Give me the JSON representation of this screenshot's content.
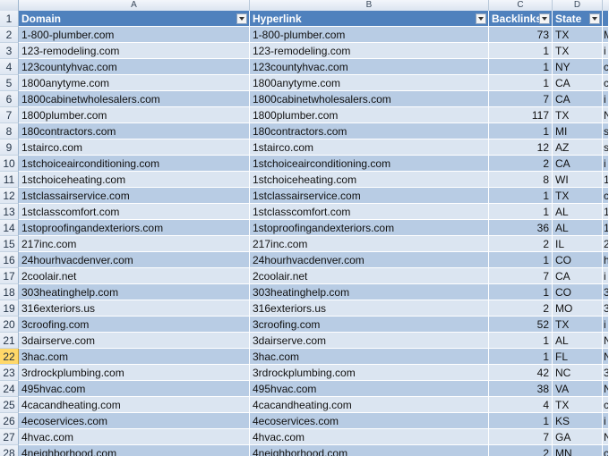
{
  "columns": [
    "A",
    "B",
    "C",
    "D"
  ],
  "table": {
    "headers": {
      "domain": "Domain",
      "hyperlink": "Hyperlink",
      "backlinks": "Backlinks",
      "state": "State"
    },
    "rows": [
      {
        "num": "2",
        "domain": "1-800-plumber.com",
        "hyperlink": "1-800-plumber.com",
        "backlinks": "73",
        "state": "TX",
        "e": "M"
      },
      {
        "num": "3",
        "domain": "123-remodeling.com",
        "hyperlink": "123-remodeling.com",
        "backlinks": "1",
        "state": "TX",
        "e": "i"
      },
      {
        "num": "4",
        "domain": "123countyhvac.com",
        "hyperlink": "123countyhvac.com",
        "backlinks": "1",
        "state": "NY",
        "e": "c"
      },
      {
        "num": "5",
        "domain": "1800anytyme.com",
        "hyperlink": "1800anytyme.com",
        "backlinks": "1",
        "state": "CA",
        "e": "c"
      },
      {
        "num": "6",
        "domain": "1800cabinetwholesalers.com",
        "hyperlink": "1800cabinetwholesalers.com",
        "backlinks": "7",
        "state": "CA",
        "e": "i"
      },
      {
        "num": "7",
        "domain": "1800plumber.com",
        "hyperlink": "1800plumber.com",
        "backlinks": "117",
        "state": "TX",
        "e": "N"
      },
      {
        "num": "8",
        "domain": "180contractors.com",
        "hyperlink": "180contractors.com",
        "backlinks": "1",
        "state": "MI",
        "e": "s"
      },
      {
        "num": "9",
        "domain": "1stairco.com",
        "hyperlink": "1stairco.com",
        "backlinks": "12",
        "state": "AZ",
        "e": "s"
      },
      {
        "num": "10",
        "domain": "1stchoiceairconditioning.com",
        "hyperlink": "1stchoiceairconditioning.com",
        "backlinks": "2",
        "state": "CA",
        "e": "i"
      },
      {
        "num": "11",
        "domain": "1stchoiceheating.com",
        "hyperlink": "1stchoiceheating.com",
        "backlinks": "8",
        "state": "WI",
        "e": "1"
      },
      {
        "num": "12",
        "domain": "1stclassairservice.com",
        "hyperlink": "1stclassairservice.com",
        "backlinks": "1",
        "state": "TX",
        "e": "c"
      },
      {
        "num": "13",
        "domain": "1stclasscomfort.com",
        "hyperlink": "1stclasscomfort.com",
        "backlinks": "1",
        "state": "AL",
        "e": "1"
      },
      {
        "num": "14",
        "domain": "1stoproofingandexteriors.com",
        "hyperlink": "1stoproofingandexteriors.com",
        "backlinks": "36",
        "state": "AL",
        "e": "1"
      },
      {
        "num": "15",
        "domain": "217inc.com",
        "hyperlink": "217inc.com",
        "backlinks": "2",
        "state": "IL",
        "e": "2"
      },
      {
        "num": "16",
        "domain": "24hourhvacdenver.com",
        "hyperlink": "24hourhvacdenver.com",
        "backlinks": "1",
        "state": "CO",
        "e": "h"
      },
      {
        "num": "17",
        "domain": "2coolair.net",
        "hyperlink": "2coolair.net",
        "backlinks": "7",
        "state": "CA",
        "e": "i"
      },
      {
        "num": "18",
        "domain": "303heatinghelp.com",
        "hyperlink": "303heatinghelp.com",
        "backlinks": "1",
        "state": "CO",
        "e": "3"
      },
      {
        "num": "19",
        "domain": "316exteriors.us",
        "hyperlink": "316exteriors.us",
        "backlinks": "2",
        "state": "MO",
        "e": "3"
      },
      {
        "num": "20",
        "domain": "3croofing.com",
        "hyperlink": "3croofing.com",
        "backlinks": "52",
        "state": "TX",
        "e": "i"
      },
      {
        "num": "21",
        "domain": "3dairserve.com",
        "hyperlink": "3dairserve.com",
        "backlinks": "1",
        "state": "AL",
        "e": "N"
      },
      {
        "num": "22",
        "domain": "3hac.com",
        "hyperlink": "3hac.com",
        "backlinks": "1",
        "state": "FL",
        "e": "N"
      },
      {
        "num": "23",
        "domain": "3rdrockplumbing.com",
        "hyperlink": "3rdrockplumbing.com",
        "backlinks": "42",
        "state": "NC",
        "e": "3"
      },
      {
        "num": "24",
        "domain": "495hvac.com",
        "hyperlink": "495hvac.com",
        "backlinks": "38",
        "state": "VA",
        "e": "N"
      },
      {
        "num": "25",
        "domain": "4cacandheating.com",
        "hyperlink": "4cacandheating.com",
        "backlinks": "4",
        "state": "TX",
        "e": "c"
      },
      {
        "num": "26",
        "domain": "4ecoservices.com",
        "hyperlink": "4ecoservices.com",
        "backlinks": "1",
        "state": "KS",
        "e": "i"
      },
      {
        "num": "27",
        "domain": "4hvac.com",
        "hyperlink": "4hvac.com",
        "backlinks": "7",
        "state": "GA",
        "e": "N"
      },
      {
        "num": "28",
        "domain": "4neighborhood.com",
        "hyperlink": "4neighborhood.com",
        "backlinks": "2",
        "state": "MN",
        "e": "c"
      }
    ]
  },
  "active_row": "22",
  "colors": {
    "header_fill": "#4f81bd",
    "band_light": "#dbe5f1",
    "band_dark": "#b8cce4",
    "active_row_header": "#ffd869"
  }
}
